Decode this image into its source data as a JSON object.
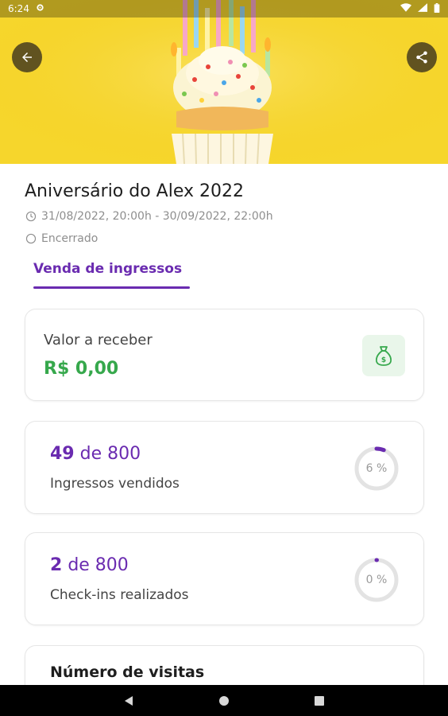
{
  "status_bar": {
    "time": "6:24",
    "icons": [
      "settings-icon",
      "wifi-icon",
      "signal-icon",
      "battery-icon"
    ]
  },
  "header": {
    "back_icon": "arrow-left-icon",
    "share_icon": "share-icon"
  },
  "event": {
    "title": "Aniversário do Alex 2022",
    "date_range": "31/08/2022, 20:00h - 30/09/2022, 22:00h",
    "status": "Encerrado"
  },
  "tabs": [
    {
      "label": "Venda de ingressos",
      "active": true
    }
  ],
  "balance_card": {
    "label": "Valor a receber",
    "value": "R$ 0,00",
    "icon": "money-bag-icon"
  },
  "tickets_card": {
    "count": "49",
    "separator": "de 800",
    "label": "Ingressos vendidos",
    "percent_label": "6 %",
    "percent": 6
  },
  "checkins_card": {
    "count": "2",
    "separator": "de 800",
    "label": "Check-ins realizados",
    "percent_label": "0 %",
    "percent": 0.25
  },
  "visits_card": {
    "title": "Número de visitas"
  },
  "colors": {
    "primary": "#6a2bb0",
    "success": "#36a84c",
    "hero_background": "#f6d62c",
    "ring_track": "#e3e3e3"
  }
}
